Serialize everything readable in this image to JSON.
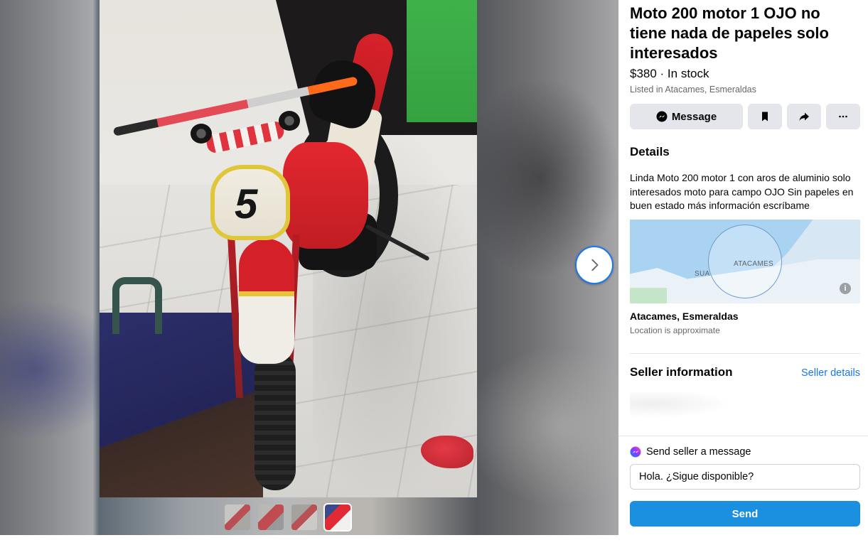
{
  "listing": {
    "title": "Moto 200 motor 1 OJO no tiene nada de papeles solo interesados",
    "price_line": "$380 · In stock",
    "listed_in": "Listed in Atacames, Esmeraldas"
  },
  "actions": {
    "message_label": "Message",
    "save_icon": "bookmark-icon",
    "share_icon": "share-icon",
    "more_icon": "more-icon"
  },
  "details": {
    "heading": "Details",
    "description": "Linda Moto 200 motor 1  con aros de aluminio solo interesados moto para campo OJO Sin papeles en buen estado más información escríbame"
  },
  "map": {
    "label_city": "ATACAMES",
    "label_town": "SUA",
    "info_icon": "i"
  },
  "location": {
    "name": "Atacames, Esmeraldas",
    "note": "Location is approximate"
  },
  "seller": {
    "heading": "Seller information",
    "link": "Seller details"
  },
  "composer": {
    "heading": "Send seller a message",
    "input_value": "Hola. ¿Sigue disponible?",
    "send_label": "Send"
  },
  "viewer": {
    "plate_number": "5",
    "thumbnail_count": 4,
    "next_icon": "chevron-right-icon"
  },
  "colors": {
    "accent": "#1877f2",
    "send_button": "#1b8fe0",
    "action_bg": "#e4e6eb",
    "secondary_text": "#65676b"
  }
}
